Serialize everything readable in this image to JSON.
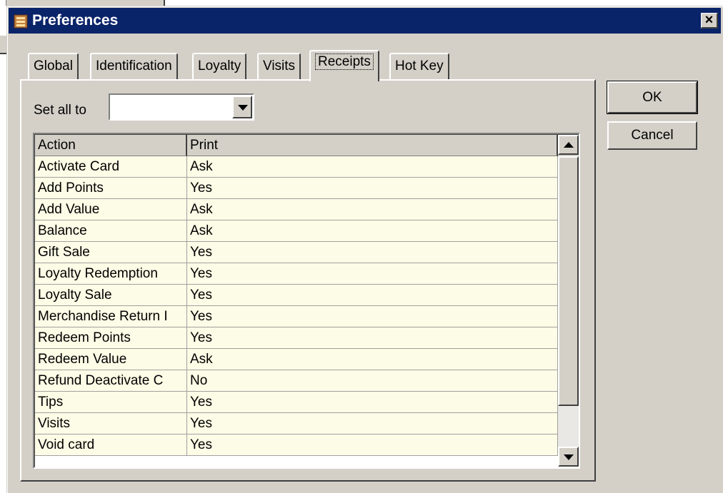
{
  "window": {
    "title": "Preferences",
    "close_label": "×"
  },
  "tabs": [
    {
      "label": "Global",
      "active": false
    },
    {
      "label": "Identification",
      "active": false
    },
    {
      "label": "Loyalty",
      "active": false
    },
    {
      "label": "Visits",
      "active": false
    },
    {
      "label": "Receipts",
      "active": true
    },
    {
      "label": "Hot Key",
      "active": false
    }
  ],
  "set_all": {
    "label": "Set all to",
    "value": ""
  },
  "grid": {
    "columns": [
      "Action",
      "Print"
    ],
    "rows": [
      {
        "action": "Activate Card",
        "print": "Ask"
      },
      {
        "action": "Add Points",
        "print": "Yes"
      },
      {
        "action": "Add Value",
        "print": "Ask"
      },
      {
        "action": "Balance",
        "print": "Ask"
      },
      {
        "action": "Gift Sale",
        "print": "Yes"
      },
      {
        "action": "Loyalty Redemption",
        "print": "Yes"
      },
      {
        "action": "Loyalty Sale",
        "print": "Yes"
      },
      {
        "action": "Merchandise Return I",
        "print": "Yes"
      },
      {
        "action": "Redeem Points",
        "print": "Yes"
      },
      {
        "action": "Redeem Value",
        "print": "Ask"
      },
      {
        "action": "Refund Deactivate C",
        "print": "No"
      },
      {
        "action": "Tips",
        "print": "Yes"
      },
      {
        "action": "Visits",
        "print": "Yes"
      },
      {
        "action": "Void card",
        "print": "Yes"
      }
    ]
  },
  "buttons": {
    "ok": "OK",
    "cancel": "Cancel"
  },
  "colors": {
    "titlebar": "#0a246a",
    "face": "#d4d0c8",
    "cell_background": "#fdfce6"
  }
}
